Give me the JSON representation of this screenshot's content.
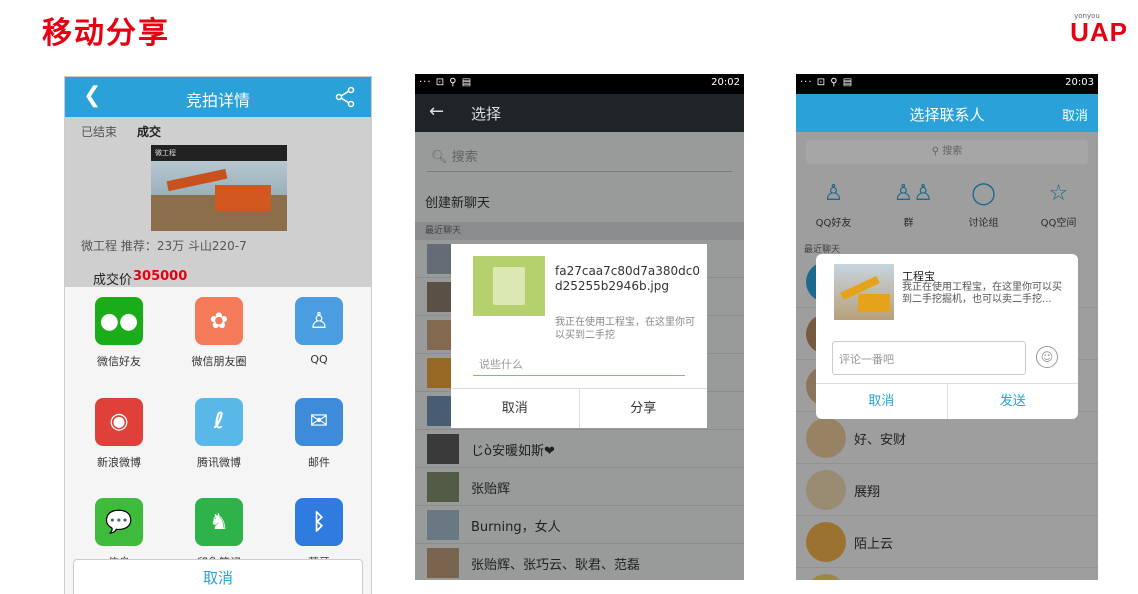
{
  "slide": {
    "title": "移动分享",
    "logo_small": "yonyou",
    "logo_big": "UAP"
  },
  "colors": {
    "accent": "#2aa1d8",
    "brand_red": "#e60012"
  },
  "phone1": {
    "header_title": "竞拍详情",
    "status_label": "已结束",
    "status_value": "成交",
    "image_bar_text": "微工程",
    "description": "微工程 推荐：23万 斗山220-7",
    "price_label": "成交价",
    "price_value": "305000",
    "share_apps": [
      {
        "label": "微信好友",
        "icon": "wechat-icon",
        "color": "#1aad19",
        "glyph": "●●"
      },
      {
        "label": "微信朋友圈",
        "icon": "moments-icon",
        "color": "#f47a5a",
        "glyph": "✿"
      },
      {
        "label": "QQ",
        "icon": "qq-icon",
        "color": "#4a9de0",
        "glyph": "♙"
      },
      {
        "label": "新浪微博",
        "icon": "weibo-icon",
        "color": "#e0403a",
        "glyph": "◉"
      },
      {
        "label": "腾讯微博",
        "icon": "tencent-weibo-icon",
        "color": "#5ab8e8",
        "glyph": "ℓ"
      },
      {
        "label": "邮件",
        "icon": "mail-icon",
        "color": "#3d8bd9",
        "glyph": "✉"
      },
      {
        "label": "信息",
        "icon": "message-icon",
        "color": "#3fbb3c",
        "glyph": "💬"
      },
      {
        "label": "印象笔记",
        "icon": "evernote-icon",
        "color": "#2db34a",
        "glyph": "♞"
      },
      {
        "label": "蓝牙",
        "icon": "bluetooth-icon",
        "color": "#2f7bde",
        "glyph": "ᛒ"
      }
    ],
    "cancel_label": "取消"
  },
  "phone2": {
    "status_left": "··· ⊡ ⚲ ▤",
    "status_right": "20:02",
    "header_title": "选择",
    "search_placeholder": "搜索",
    "new_chat": "创建新聊天",
    "recent_label": "最近聊天",
    "contacts": [
      {
        "name": "じò安暖如斯❤"
      },
      {
        "name": "张贻辉"
      },
      {
        "name": "Burning，女人"
      },
      {
        "name": "张贻辉、张巧云、耿君、范磊"
      }
    ],
    "dialog": {
      "file_name": "fa27caa7c80d7a380dc0d25255b2946b.jpg",
      "file_desc": "我正在使用工程宝，在这里你可以买到二手挖",
      "input_placeholder": "说些什么",
      "cancel": "取消",
      "share": "分享"
    }
  },
  "phone3": {
    "status_left": "··· ⊡ ⚲ ▤",
    "status_right": "20:03",
    "header_title": "选择联系人",
    "header_cancel": "取消",
    "search_placeholder": "搜索",
    "categories": [
      {
        "label": "QQ好友",
        "icon": "person-icon",
        "glyph": "♙"
      },
      {
        "label": "群",
        "icon": "group-icon",
        "glyph": "♙♙"
      },
      {
        "label": "讨论组",
        "icon": "chat-bubble-icon",
        "glyph": "◯"
      },
      {
        "label": "QQ空间",
        "icon": "star-icon",
        "glyph": "☆"
      }
    ],
    "recent_label": "最近聊天",
    "contacts": [
      {
        "name": "好、安财"
      },
      {
        "name": "展翔"
      },
      {
        "name": "陌上云"
      }
    ],
    "dialog": {
      "title": "工程宝",
      "desc": "我正在使用工程宝，在这里你可以买到二手挖掘机，也可以卖二手挖...",
      "input_placeholder": "评论一番吧",
      "cancel": "取消",
      "send": "发送"
    }
  }
}
